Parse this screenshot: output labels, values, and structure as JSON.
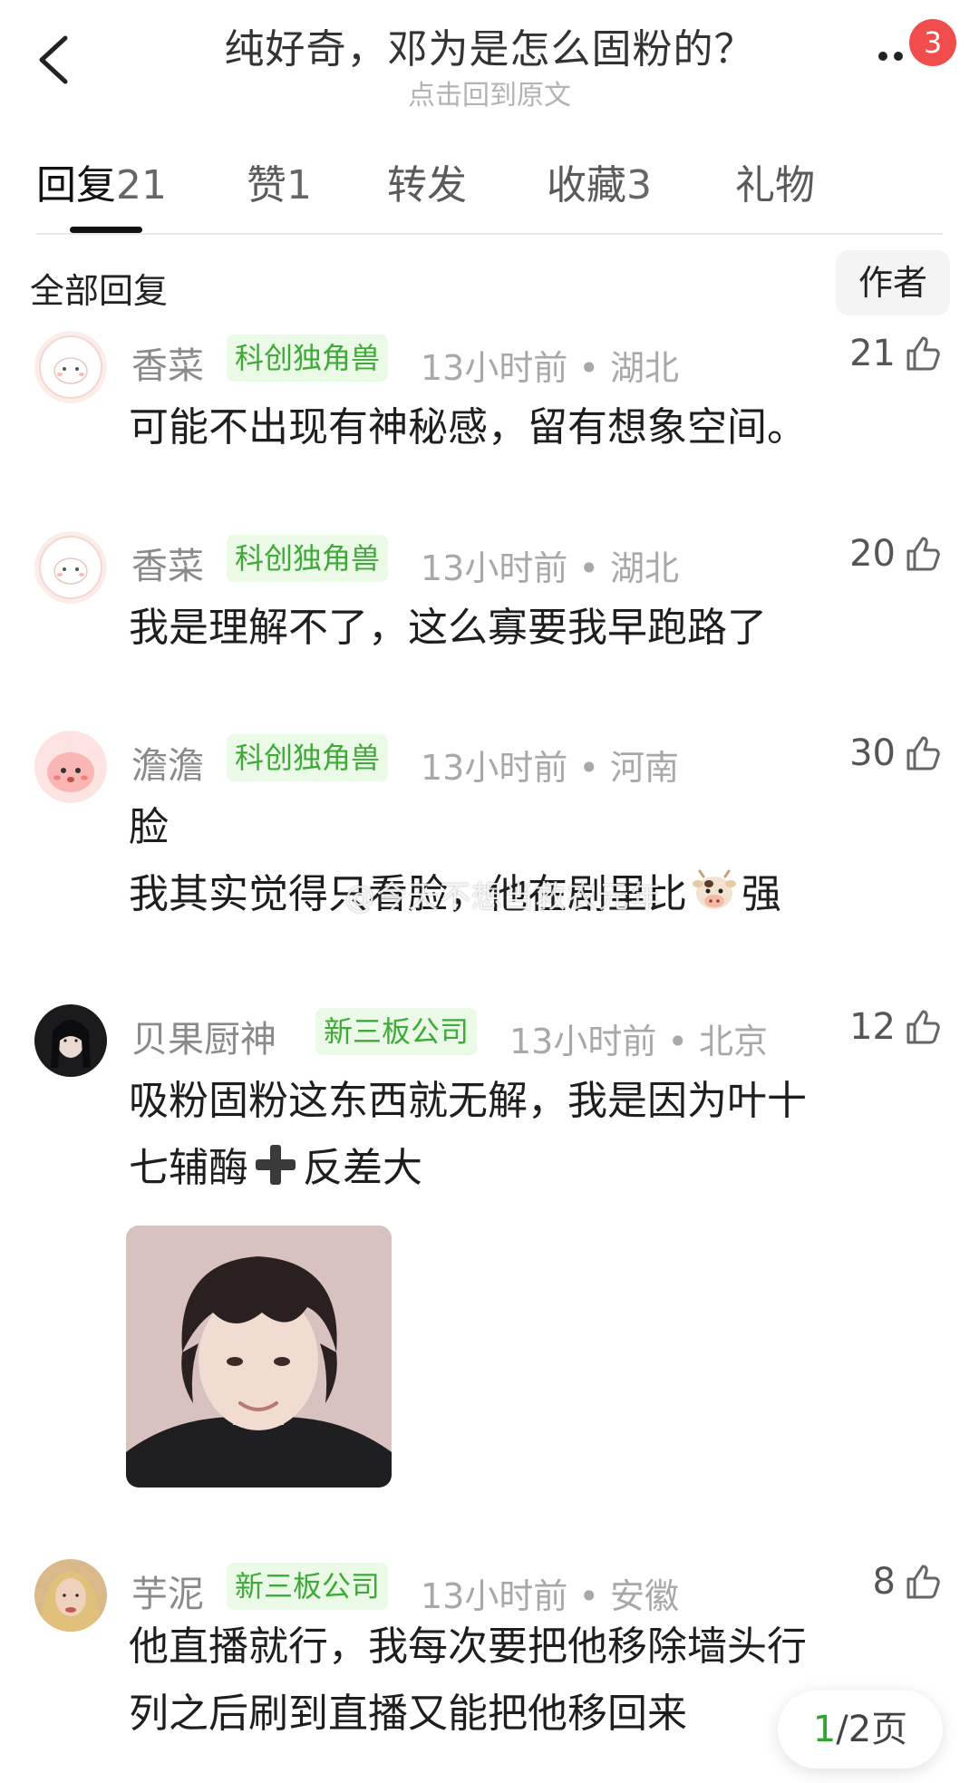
{
  "header": {
    "title": "纯好奇，邓为是怎么固粉的？",
    "subtitle": "点击回到原文",
    "more_badge": "3",
    "icons": {
      "back": "back-arrow-icon",
      "more": "more-dots-icon"
    },
    "badge_color": "#f24d4d"
  },
  "tabs": [
    {
      "label": "回复",
      "count": "21",
      "active": true
    },
    {
      "label": "赞",
      "count": "1",
      "active": false
    },
    {
      "label": "转发",
      "count": "",
      "active": false
    },
    {
      "label": "收藏",
      "count": "3",
      "active": false
    },
    {
      "label": "礼物",
      "count": "",
      "active": false
    }
  ],
  "section": {
    "title": "全部回复",
    "author_filter": "作者"
  },
  "accent_green": "#3fa93a",
  "comments": [
    {
      "name": "香菜",
      "badge": "科创独角兽",
      "time": "13小时前",
      "location": "湖北",
      "likes": "21",
      "lines": [
        "可能不出现有神秘感，留有想象空间。"
      ]
    },
    {
      "name": "香菜",
      "badge": "科创独角兽",
      "time": "13小时前",
      "location": "湖北",
      "likes": "20",
      "lines": [
        "我是理解不了，这么寡要我早跑路了"
      ]
    },
    {
      "name": "澹澹",
      "badge": "科创独角兽",
      "time": "13小时前",
      "location": "河南",
      "likes": "30",
      "lines": [
        "脸",
        "我其实觉得只看脸，他在剧里比",
        "强"
      ],
      "emoji": "cow-face-emoji"
    },
    {
      "name": "贝果厨神",
      "badge": "新三板公司",
      "time": "13小时前",
      "location": "北京",
      "likes": "12",
      "lines": [
        "吸粉固粉这东西就无解，我是因为叶十",
        "七辅酶",
        "反差大"
      ],
      "emoji": "plus-emoji",
      "has_photo": true
    },
    {
      "name": "芋泥",
      "badge": "新三板公司",
      "time": "13小时前",
      "location": "安徽",
      "likes": "8",
      "lines": [
        "他直播就行，我每次要把他移除墙头行",
        "列之后刷到直播又能把他移回来"
      ]
    }
  ],
  "pager": {
    "current": "1",
    "total": "/2页"
  },
  "watermark": "@今天不想当救农元年"
}
